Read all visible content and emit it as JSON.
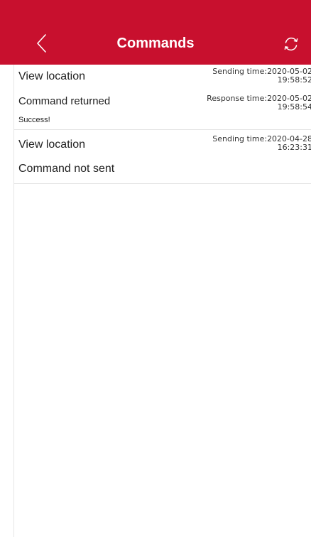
{
  "header": {
    "title": "Commands",
    "background": "#c8102e",
    "back_icon": "chevron-left-icon",
    "refresh_icon": "refresh-icon"
  },
  "commands": [
    {
      "name": "View location",
      "sending_time_label": "Sending time:",
      "sending_date": "2020-05-02",
      "sending_clock": "19:58:52",
      "status": "Command returned",
      "response_time_label": "Response time:",
      "response_date": "2020-05-02",
      "response_clock": "19:58:54",
      "result": "Success!"
    },
    {
      "name": "View location",
      "sending_time_label": "Sending time:",
      "sending_date": "2020-04-28",
      "sending_clock": "16:23:31",
      "status": "Command not sent"
    }
  ]
}
